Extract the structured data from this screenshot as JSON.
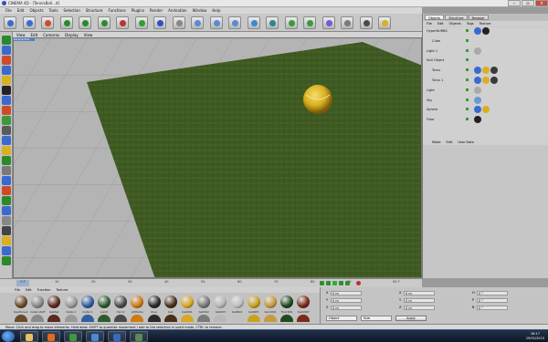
{
  "window": {
    "title": "CINEMA 4D - [TennisBall...d]"
  },
  "menu": [
    "File",
    "Edit",
    "Objects",
    "Tools",
    "Selection",
    "Structure",
    "Functions",
    "Plugins",
    "Render",
    "Animation",
    "Window",
    "Help"
  ],
  "toolbar": {
    "icons": [
      "undo-icon",
      "redo-icon",
      "select-icon",
      "move-icon",
      "scale-icon",
      "rotate-icon",
      "x-axis-icon",
      "y-axis-icon",
      "z-axis-icon",
      "world-icon",
      "render-view-icon",
      "render-picture-icon",
      "render-settings-icon",
      "cube-icon",
      "spline-icon",
      "nurbs-icon",
      "array-icon",
      "deformer-icon",
      "scene-icon",
      "camera-icon",
      "light-icon"
    ]
  },
  "viewport": {
    "menu": [
      "View",
      "Edit",
      "Cameras",
      "Display",
      "View"
    ],
    "tab_label": "Perspective",
    "colors": {
      "floor": "#b4b4b4",
      "grass": "#3e5a22",
      "ball": "#d8b020"
    }
  },
  "right_panel": {
    "tabs": [
      "Objects",
      "Structure",
      "Browser"
    ],
    "menu": [
      "File",
      "Edit",
      "Objects",
      "Tags",
      "Texture"
    ],
    "objects": [
      {
        "name": "HyperNURBS"
      },
      {
        "name": "Cube"
      },
      {
        "name": "Light 1"
      },
      {
        "name": "Null Object"
      },
      {
        "name": "Torus"
      },
      {
        "name": "Torus 1"
      },
      {
        "name": "Light"
      },
      {
        "name": "Sky"
      },
      {
        "name": "Sphere"
      },
      {
        "name": "Floor"
      }
    ],
    "attr_menu": [
      "Mode",
      "Edit",
      "User Data"
    ]
  },
  "timeline": {
    "frame_start": "0 F",
    "marks": [
      "10",
      "20",
      "30",
      "40",
      "50",
      "60",
      "70",
      "80",
      "90"
    ],
    "frame_end": "90 F"
  },
  "material_manager": {
    "menu": [
      "File",
      "Edit",
      "Function",
      "Texture"
    ],
    "materials": [
      {
        "label": "beethoven",
        "color": "#6a4a2a"
      },
      {
        "label": "metal stuff",
        "color": "#8a8a8a"
      },
      {
        "label": "leather",
        "color": "#5a2a1e"
      },
      {
        "label": "metal 1",
        "color": "#9a9a9a"
      },
      {
        "label": "metal 1",
        "color": "#2f5fa0"
      },
      {
        "label": "paint",
        "color": "#2e5a2e"
      },
      {
        "label": "mirror",
        "color": "#4a4a4a"
      },
      {
        "label": "pt/flame",
        "color": "#d07a10"
      },
      {
        "label": "blue",
        "color": "#2a2a2a"
      },
      {
        "label": "ball",
        "color": "#4a3018"
      },
      {
        "label": "ball001",
        "color": "#d8a820"
      },
      {
        "label": "ball002",
        "color": "#7a7a7a"
      },
      {
        "label": "ball003",
        "color": "#b8b8b8"
      },
      {
        "label": "ball004",
        "color": "#c0c0c0"
      },
      {
        "label": "ball005",
        "color": "#c9a21e"
      },
      {
        "label": "back001",
        "color": "#c89a40"
      },
      {
        "label": "floor001",
        "color": "#1f4a1f"
      },
      {
        "label": "back007",
        "color": "#7a2a1a"
      }
    ]
  },
  "coords": {
    "rows": [
      {
        "a": "X",
        "av": "0 m",
        "b": "X",
        "bv": "0 m",
        "c": "H",
        "cv": "0 °"
      },
      {
        "a": "Y",
        "av": "0 m",
        "b": "Y",
        "bv": "0 m",
        "c": "P",
        "cv": "0 °"
      },
      {
        "a": "Z",
        "av": "0 m",
        "b": "Z",
        "bv": "0 m",
        "c": "B",
        "cv": "0 °"
      }
    ],
    "mode_select": "Object",
    "size_select": "Size",
    "apply_label": "Apply"
  },
  "status": "Move: Click and drag to move elements. Hold down SHIFT to quantize movement / add to the selection in point mode, CTRL to remove.",
  "taskbar": {
    "apps": [
      {
        "name": "explorer-icon",
        "color": "#e8c060"
      },
      {
        "name": "firefox-icon",
        "color": "#e06a20"
      },
      {
        "name": "chrome-icon",
        "color": "#3a9a40"
      },
      {
        "name": "media-icon",
        "color": "#4a8ad0"
      },
      {
        "name": "c4d-icon",
        "color": "#3a6ac0"
      },
      {
        "name": "app-icon",
        "color": "#5a8a5a"
      }
    ],
    "time": "18:17",
    "date": "19/02/2010"
  }
}
